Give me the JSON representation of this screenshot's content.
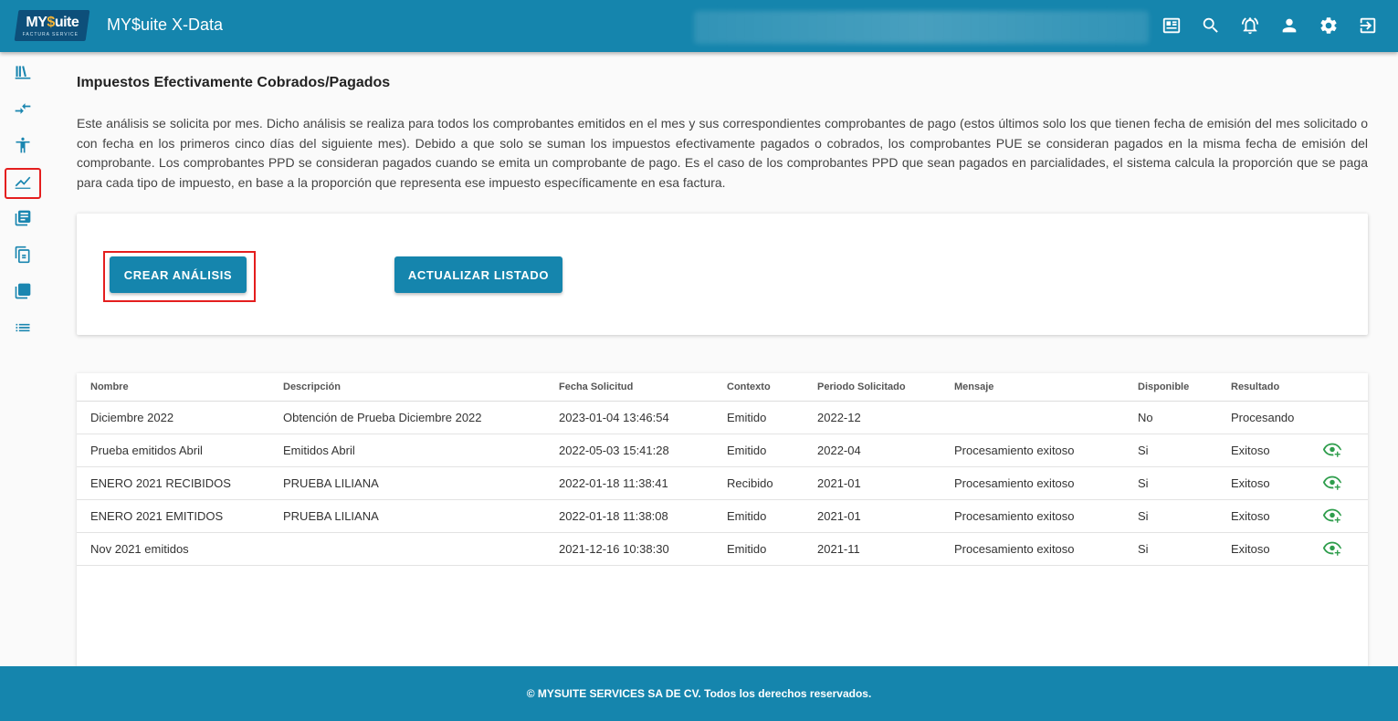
{
  "app": {
    "logo_text_a": "MY",
    "logo_text_b": "$",
    "logo_text_c": "uite",
    "logo_sub": "FACTURA SERVICE",
    "title": "MY$uite X-Data"
  },
  "topbar_icons": [
    "news-icon",
    "search-icon",
    "alarm-icon",
    "user-icon",
    "settings-icon",
    "logout-icon"
  ],
  "sidebar_icons": [
    "library-icon",
    "compare-arrows-icon",
    "accessibility-icon",
    "chart-line-icon",
    "document-list-icon",
    "copy-icon",
    "library-books-icon",
    "list-icon"
  ],
  "page": {
    "title": "Impuestos Efectivamente Cobrados/Pagados",
    "description": "Este análisis se solicita por mes. Dicho análisis se realiza para todos los comprobantes emitidos en el mes y sus correspondientes comprobantes de pago (estos últimos solo los que tienen fecha de emisión del mes solicitado o con fecha en los primeros cinco días del siguiente mes). Debido a que solo se suman los impuestos efectivamente pagados o cobrados, los comprobantes PUE se consideran pagados en la misma fecha de emisión del comprobante. Los comprobantes PPD se consideran pagados cuando se emita un comprobante de pago. Es el caso de los comprobantes PPD que sean pagados en parcialidades, el sistema calcula la proporción que se paga para cada tipo de impuesto, en base a la proporción que representa ese impuesto específicamente en esa factura."
  },
  "actions": {
    "create_label": "CREAR ANÁLISIS",
    "refresh_label": "ACTUALIZAR LISTADO"
  },
  "table": {
    "headers": [
      "Nombre",
      "Descripción",
      "Fecha Solicitud",
      "Contexto",
      "Periodo Solicitado",
      "Mensaje",
      "Disponible",
      "Resultado"
    ],
    "rows": [
      [
        "Diciembre 2022",
        "Obtención de Prueba Diciembre 2022",
        "2023-01-04 13:46:54",
        "Emitido",
        "2022-12",
        "",
        "No",
        "Procesando"
      ],
      [
        "Prueba emitidos Abril",
        "Emitidos Abril",
        "2022-05-03 15:41:28",
        "Emitido",
        "2022-04",
        "Procesamiento exitoso",
        "Si",
        "Exitoso"
      ],
      [
        "ENERO 2021 RECIBIDOS",
        "PRUEBA LILIANA",
        "2022-01-18 11:38:41",
        "Recibido",
        "2021-01",
        "Procesamiento exitoso",
        "Si",
        "Exitoso"
      ],
      [
        "ENERO 2021 EMITIDOS",
        "PRUEBA LILIANA",
        "2022-01-18 11:38:08",
        "Emitido",
        "2021-01",
        "Procesamiento exitoso",
        "Si",
        "Exitoso"
      ],
      [
        "Nov 2021 emitidos",
        "",
        "2021-12-16 10:38:30",
        "Emitido",
        "2021-11",
        "Procesamiento exitoso",
        "Si",
        "Exitoso"
      ]
    ]
  },
  "footer": {
    "text": "© MYSUITE SERVICES SA DE CV. Todos los derechos reservados."
  },
  "colors": {
    "primary": "#1585ad",
    "highlight": "#e41e1e",
    "view_icon": "#2e9d4c"
  }
}
